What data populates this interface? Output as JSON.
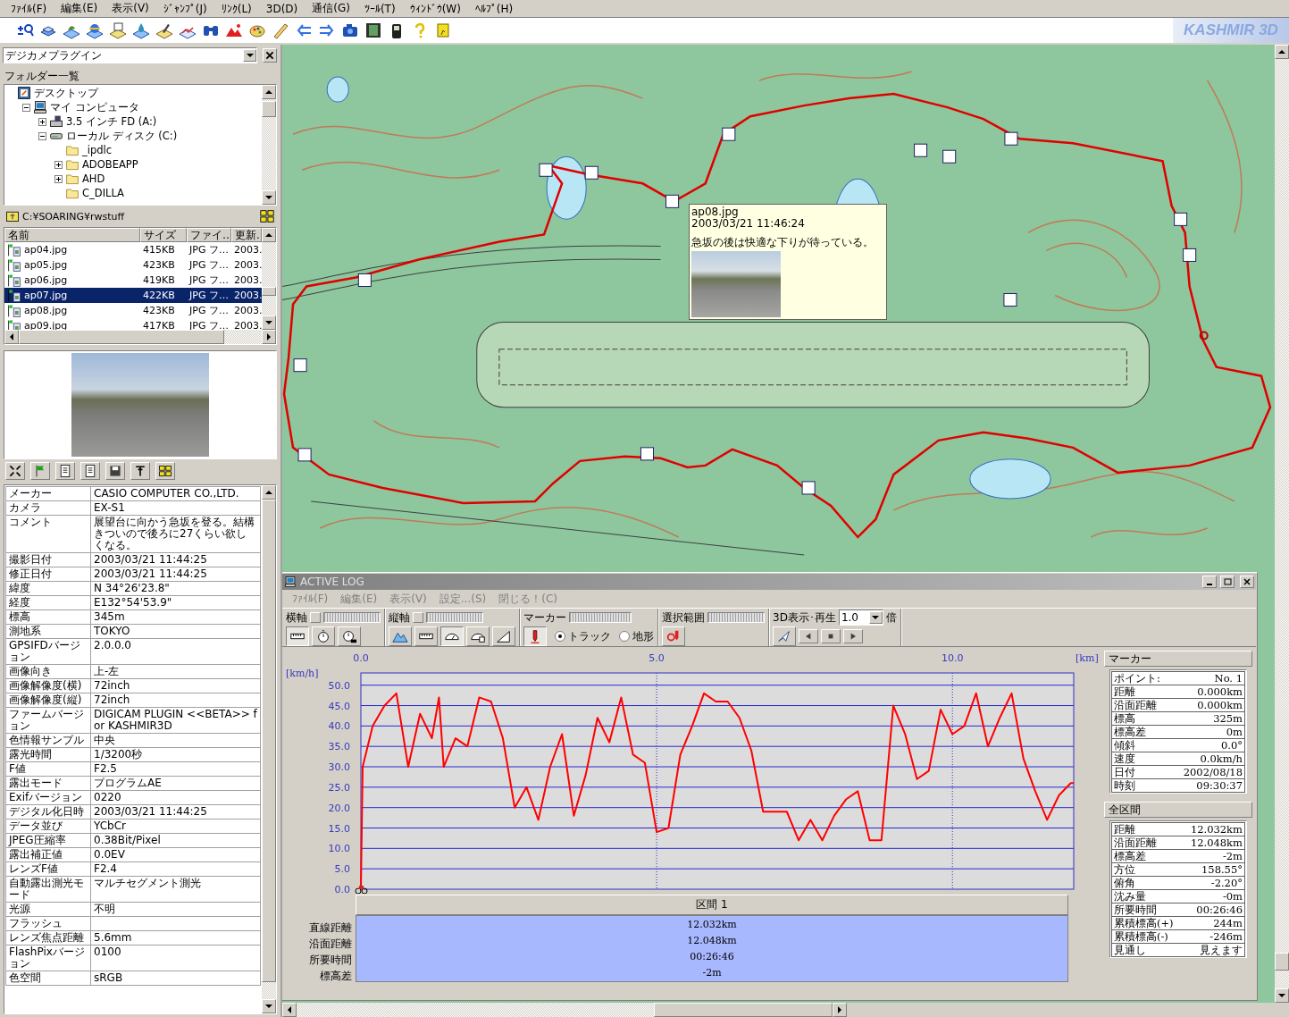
{
  "menu": [
    "ﾌｧｲﾙ(F)",
    "編集(E)",
    "表示(V)",
    "ｼﾞｬﾝﾌﾟ(J)",
    "ﾘﾝｸ(L)",
    "3D(D)",
    "通信(G)",
    "ﾂｰﾙ(T)",
    "ｳｨﾝﾄﾞｳ(W)",
    "ﾍﾙﾌﾟ(H)"
  ],
  "logo": "KASHMIR 3D",
  "plugin_select": {
    "value": "デジカメプラグイン"
  },
  "folder_label": "フォルダー一覧",
  "tree": [
    {
      "label": "デスクトップ",
      "kind": "desktop",
      "children": [
        {
          "label": "マイ コンピュータ",
          "kind": "computer",
          "expanded": true,
          "children": [
            {
              "label": "3.5 インチ FD (A:)",
              "kind": "floppy",
              "expanded": false
            },
            {
              "label": "ローカル ディスク (C:)",
              "kind": "drive",
              "expanded": true,
              "children": [
                {
                  "label": "_ipdlc",
                  "kind": "folder"
                },
                {
                  "label": "ADOBEAPP",
                  "kind": "folder",
                  "expanded": false
                },
                {
                  "label": "AHD",
                  "kind": "folder",
                  "expanded": false
                },
                {
                  "label": "C_DILLA",
                  "kind": "folder"
                }
              ]
            }
          ]
        }
      ]
    }
  ],
  "path": "C:¥SOARING¥rwstuff",
  "file_list": {
    "columns": [
      "名前",
      "サイズ",
      "ファイ…",
      "更新."
    ],
    "rows": [
      {
        "name": "ap04.jpg",
        "size": "415KB",
        "type": "JPG フ…",
        "date": "2003.",
        "selected": false
      },
      {
        "name": "ap05.jpg",
        "size": "423KB",
        "type": "JPG フ…",
        "date": "2003.",
        "selected": false
      },
      {
        "name": "ap06.jpg",
        "size": "419KB",
        "type": "JPG フ…",
        "date": "2003.",
        "selected": false
      },
      {
        "name": "ap07.jpg",
        "size": "422KB",
        "type": "JPG フ…",
        "date": "2003.",
        "selected": true
      },
      {
        "name": "ap08.jpg",
        "size": "423KB",
        "type": "JPG フ…",
        "date": "2003.",
        "selected": false
      },
      {
        "name": "ap09.jpg",
        "size": "417KB",
        "type": "JPG フ…",
        "date": "2003.",
        "selected": false
      }
    ]
  },
  "properties": [
    {
      "label": "メーカー",
      "value": "CASIO COMPUTER CO.,LTD."
    },
    {
      "label": "カメラ",
      "value": "EX-S1"
    },
    {
      "label": "コメント",
      "value": "展望台に向かう急坂を登る。結構きついので後ろに27くらい欲しくなる。"
    },
    {
      "label": "撮影日付",
      "value": "2003/03/21 11:44:25"
    },
    {
      "label": "修正日付",
      "value": "2003/03/21 11:44:25"
    },
    {
      "label": "緯度",
      "value": "N 34°26'23.8\""
    },
    {
      "label": "経度",
      "value": "E132°54'53.9\""
    },
    {
      "label": "標高",
      "value": "345m"
    },
    {
      "label": "測地系",
      "value": "TOKYO"
    },
    {
      "label": "GPSIFDバージョン",
      "value": "2.0.0.0"
    },
    {
      "label": "画像向き",
      "value": "上-左"
    },
    {
      "label": "画像解像度(横)",
      "value": "72inch"
    },
    {
      "label": "画像解像度(縦)",
      "value": "72inch"
    },
    {
      "label": "ファームバージョン",
      "value": "DIGICAM PLUGIN <<BETA>> for KASHMIR3D"
    },
    {
      "label": "色情報サンプル",
      "value": "中央"
    },
    {
      "label": "露光時間",
      "value": "1/3200秒"
    },
    {
      "label": "F値",
      "value": "F2.5"
    },
    {
      "label": "露出モード",
      "value": "プログラムAE"
    },
    {
      "label": "Exifバージョン",
      "value": "0220"
    },
    {
      "label": "デジタル化日時",
      "value": "2003/03/21 11:44:25"
    },
    {
      "label": "データ並び",
      "value": "YCbCr"
    },
    {
      "label": "JPEG圧縮率",
      "value": "0.38Bit/Pixel"
    },
    {
      "label": "露出補正値",
      "value": "0.0EV"
    },
    {
      "label": "レンズF値",
      "value": "F2.4"
    },
    {
      "label": "自動露出測光モード",
      "value": "マルチセグメント測光"
    },
    {
      "label": "光源",
      "value": "不明"
    },
    {
      "label": "フラッシュ"
    },
    {
      "label": "レンズ焦点距離",
      "value": "5.6mm"
    },
    {
      "label": "FlashPixバージョン",
      "value": "0100"
    },
    {
      "label": "色空間",
      "value": "sRGB"
    }
  ],
  "tooltip": {
    "file": "ap08.jpg",
    "time": "2003/03/21 11:46:24",
    "comment": "急坂の後は快適な下りが待っている。"
  },
  "log_window": {
    "title": "ACTIVE LOG",
    "menu": [
      "ﾌｧｲﾙ(F)",
      "編集(E)",
      "表示(V)",
      "設定...(S)",
      "閉じる！(C)"
    ],
    "toolbar": [
      {
        "label": "横軸",
        "buttons": [
          {
            "kind": "ruler",
            "pressed": true
          },
          {
            "kind": "stopwatch",
            "pressed": false
          },
          {
            "kind": "clock",
            "pressed": false
          }
        ]
      },
      {
        "label": "縦軸",
        "buttons": [
          {
            "kind": "mountain",
            "pressed": false
          },
          {
            "kind": "ruler",
            "pressed": false
          },
          {
            "kind": "gauge",
            "pressed": true
          },
          {
            "kind": "gauge2",
            "pressed": false
          },
          {
            "kind": "slope",
            "pressed": false
          }
        ]
      },
      {
        "label": "マーカー",
        "buttons": [
          {
            "kind": "marker",
            "pressed": true
          }
        ]
      },
      {
        "label": "選択範囲",
        "buttons": [
          {
            "kind": "range",
            "pressed": false
          }
        ]
      },
      {
        "label": "3D表示･再生",
        "buttons": [
          {
            "kind": "fly3d",
            "pressed": false
          },
          {
            "kind": "prev",
            "pressed": false
          },
          {
            "kind": "stop",
            "pressed": false
          },
          {
            "kind": "next",
            "pressed": false
          }
        ]
      }
    ],
    "radios": [
      {
        "label": "トラック",
        "selected": true
      },
      {
        "label": "地形",
        "selected": false
      }
    ],
    "speed": "1.0",
    "speed_unit": "倍",
    "chart_data": {
      "type": "line",
      "xlabel": "[km]",
      "ylabel": "[km/h]",
      "x": [
        0,
        0.03,
        0.2,
        0.4,
        0.6,
        0.8,
        1.0,
        1.2,
        1.32,
        1.4,
        1.6,
        1.8,
        2.0,
        2.2,
        2.4,
        2.6,
        2.8,
        3.0,
        3.2,
        3.4,
        3.6,
        3.8,
        4.0,
        4.2,
        4.4,
        4.6,
        4.8,
        5.0,
        5.2,
        5.4,
        5.6,
        5.8,
        6.0,
        6.2,
        6.4,
        6.6,
        6.8,
        7.0,
        7.2,
        7.4,
        7.6,
        7.8,
        8.0,
        8.2,
        8.4,
        8.6,
        8.8,
        9.0,
        9.2,
        9.4,
        9.6,
        9.8,
        10.0,
        10.2,
        10.4,
        10.6,
        10.8,
        11.0,
        11.2,
        11.4,
        11.6,
        11.8,
        12.0,
        12.05
      ],
      "series": [
        {
          "color": "#ff0000",
          "values": [
            0,
            30,
            40,
            45,
            48,
            30,
            43,
            37,
            47,
            30,
            37,
            35,
            47,
            46,
            37,
            20,
            25,
            17,
            30,
            38,
            18,
            28,
            42,
            36,
            47,
            33,
            31,
            14,
            15,
            33,
            40,
            48,
            46,
            46,
            42,
            34,
            19,
            19,
            19,
            12,
            17,
            12,
            18,
            22,
            24,
            12,
            12,
            45,
            38,
            27,
            29,
            44,
            38,
            40,
            48,
            35,
            42,
            48,
            32,
            24,
            17,
            23,
            26,
            26
          ]
        }
      ],
      "xlim": [
        0,
        12.05
      ],
      "ylim": [
        0,
        53
      ],
      "grid": true,
      "xticks": [
        {
          "value": 0,
          "label": "0.0"
        },
        {
          "value": 5,
          "label": "5.0"
        },
        {
          "value": 10,
          "label": "10.0"
        }
      ],
      "yticks": [
        {
          "value": 0,
          "label": "0.0"
        },
        {
          "value": 5,
          "label": "5.0"
        },
        {
          "value": 10,
          "label": "10.0"
        },
        {
          "value": 15,
          "label": "15.0"
        },
        {
          "value": 20,
          "label": "20.0"
        },
        {
          "value": 25,
          "label": "25.0"
        },
        {
          "value": 30,
          "label": "30.0"
        },
        {
          "value": 35,
          "label": "35.0"
        },
        {
          "value": 40,
          "label": "40.0"
        },
        {
          "value": 45,
          "label": "45.0"
        },
        {
          "value": 50,
          "label": "50.0"
        }
      ]
    },
    "segment": {
      "title": "区間 1",
      "rows": [
        {
          "label": "直線距離",
          "value": "12.032km"
        },
        {
          "label": "沿面距離",
          "value": "12.048km"
        },
        {
          "label": "所要時間",
          "value": "00:26:46"
        },
        {
          "label": "標高差",
          "value": "-2m"
        }
      ]
    },
    "marker_panel": {
      "title": "マーカー",
      "rows": [
        {
          "label": "ポイント:",
          "value": "No. 1"
        },
        {
          "label": "距離",
          "value": "0.000km"
        },
        {
          "label": "沿面距離",
          "value": "0.000km"
        },
        {
          "label": "標高",
          "value": "325m"
        },
        {
          "label": "標高差",
          "value": "0m"
        },
        {
          "label": "傾斜",
          "value": "0.0°"
        },
        {
          "label": "速度",
          "value": "0.0km/h"
        },
        {
          "label": "日付",
          "value": "2002/08/18"
        },
        {
          "label": "時刻",
          "value": "09:30:37"
        }
      ]
    },
    "total_panel": {
      "title": "全区間",
      "rows": [
        {
          "label": "距離",
          "value": "12.032km"
        },
        {
          "label": "沿面距離",
          "value": "12.048km"
        },
        {
          "label": "標高差",
          "value": "-2m"
        },
        {
          "label": "方位",
          "value": "158.55°"
        },
        {
          "label": "俯角",
          "value": "-2.20°"
        },
        {
          "label": "沈み量",
          "value": "-0m"
        },
        {
          "label": "所要時間",
          "value": "00:26:46"
        },
        {
          "label": "累積標高(+)",
          "value": "244m"
        },
        {
          "label": "累積標高(-)",
          "value": "-246m"
        },
        {
          "label": "見通し",
          "value": "見えます"
        }
      ]
    }
  }
}
